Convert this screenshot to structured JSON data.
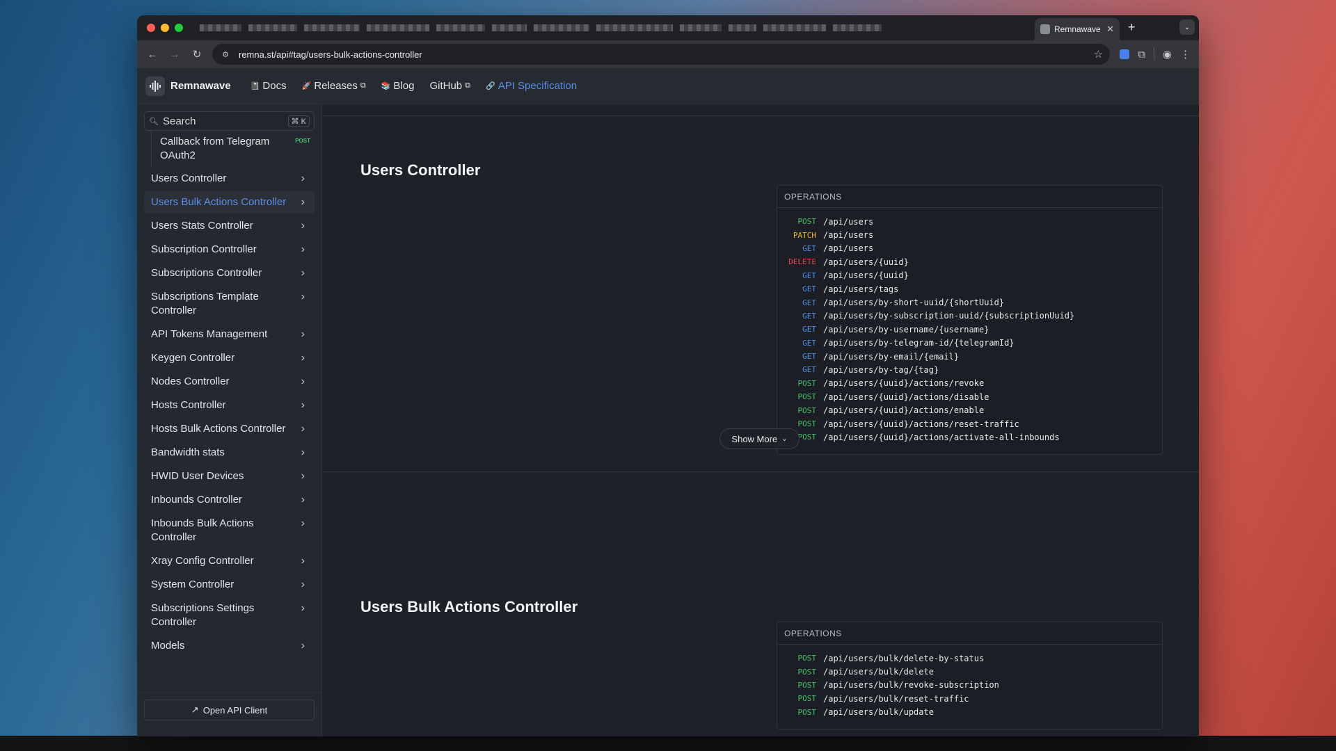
{
  "browser": {
    "active_tab_title": "Remnawave A",
    "url": "remna.st/api#tag/users-bulk-actions-controller"
  },
  "topnav": {
    "brand": "Remnawave",
    "links": [
      {
        "label": "Docs",
        "external": false,
        "icon": "📓"
      },
      {
        "label": "Releases",
        "external": true,
        "icon": "🚀"
      },
      {
        "label": "Blog",
        "external": false,
        "icon": "📚"
      },
      {
        "label": "GitHub",
        "external": true,
        "icon": ""
      },
      {
        "label": "API Specification",
        "external": false,
        "icon": "🔗"
      }
    ]
  },
  "sidebar": {
    "search_label": "Search",
    "search_shortcut": "⌘ K",
    "sub_item": {
      "label": "Callback from Telegram OAuth2",
      "method": "POST"
    },
    "items": [
      {
        "label": "Users Controller",
        "active": false
      },
      {
        "label": "Users Bulk Actions Controller",
        "active": true
      },
      {
        "label": "Users Stats Controller",
        "active": false
      },
      {
        "label": "Subscription Controller",
        "active": false
      },
      {
        "label": "Subscriptions Controller",
        "active": false
      },
      {
        "label": "Subscriptions Template Controller",
        "active": false
      },
      {
        "label": "API Tokens Management",
        "active": false
      },
      {
        "label": "Keygen Controller",
        "active": false
      },
      {
        "label": "Nodes Controller",
        "active": false
      },
      {
        "label": "Hosts Controller",
        "active": false
      },
      {
        "label": "Hosts Bulk Actions Controller",
        "active": false
      },
      {
        "label": "Bandwidth stats",
        "active": false
      },
      {
        "label": "HWID User Devices",
        "active": false
      },
      {
        "label": "Inbounds Controller",
        "active": false
      },
      {
        "label": "Inbounds Bulk Actions Controller",
        "active": false
      },
      {
        "label": "Xray Config Controller",
        "active": false
      },
      {
        "label": "System Controller",
        "active": false
      },
      {
        "label": "Subscriptions Settings Controller",
        "active": false
      },
      {
        "label": "Models",
        "active": false
      }
    ],
    "footer_button": "Open API Client"
  },
  "sections": [
    {
      "title": "Users Controller",
      "ops_header": "OPERATIONS",
      "operations": [
        {
          "method": "POST",
          "path": "/api/users"
        },
        {
          "method": "PATCH",
          "path": "/api/users"
        },
        {
          "method": "GET",
          "path": "/api/users"
        },
        {
          "method": "DELETE",
          "path": "/api/users/{uuid}"
        },
        {
          "method": "GET",
          "path": "/api/users/{uuid}"
        },
        {
          "method": "GET",
          "path": "/api/users/tags"
        },
        {
          "method": "GET",
          "path": "/api/users/by-short-uuid/{shortUuid}"
        },
        {
          "method": "GET",
          "path": "/api/users/by-subscription-uuid/{subscriptionUuid}"
        },
        {
          "method": "GET",
          "path": "/api/users/by-username/{username}"
        },
        {
          "method": "GET",
          "path": "/api/users/by-telegram-id/{telegramId}"
        },
        {
          "method": "GET",
          "path": "/api/users/by-email/{email}"
        },
        {
          "method": "GET",
          "path": "/api/users/by-tag/{tag}"
        },
        {
          "method": "POST",
          "path": "/api/users/{uuid}/actions/revoke"
        },
        {
          "method": "POST",
          "path": "/api/users/{uuid}/actions/disable"
        },
        {
          "method": "POST",
          "path": "/api/users/{uuid}/actions/enable"
        },
        {
          "method": "POST",
          "path": "/api/users/{uuid}/actions/reset-traffic"
        },
        {
          "method": "POST",
          "path": "/api/users/{uuid}/actions/activate-all-inbounds"
        }
      ],
      "show_more": "Show More"
    },
    {
      "title": "Users Bulk Actions Controller",
      "ops_header": "OPERATIONS",
      "operations": [
        {
          "method": "POST",
          "path": "/api/users/bulk/delete-by-status"
        },
        {
          "method": "POST",
          "path": "/api/users/bulk/delete"
        },
        {
          "method": "POST",
          "path": "/api/users/bulk/revoke-subscription"
        },
        {
          "method": "POST",
          "path": "/api/users/bulk/reset-traffic"
        },
        {
          "method": "POST",
          "path": "/api/users/bulk/update"
        }
      ]
    }
  ],
  "colors": {
    "POST": "#45c06a",
    "GET": "#4e8fe8",
    "PATCH": "#e9b52b",
    "DELETE": "#e84b4b",
    "accent": "#5b8ee6"
  }
}
